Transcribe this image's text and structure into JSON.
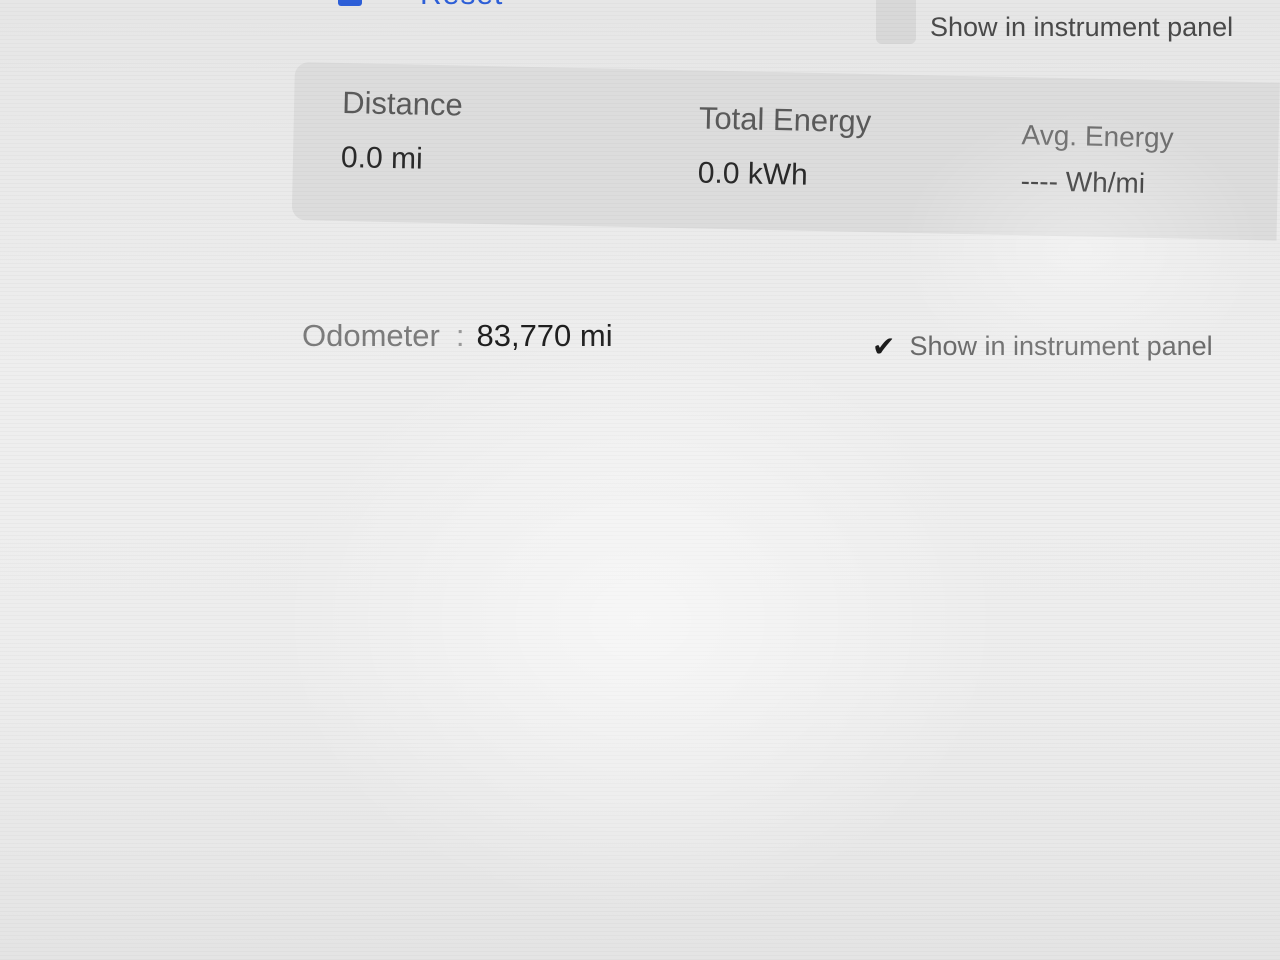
{
  "header": {
    "reset_label": "Reset",
    "show_in_panel_label": "Show in instrument panel"
  },
  "trip": {
    "distance": {
      "label": "Distance",
      "value": "0.0 mi"
    },
    "total_energy": {
      "label": "Total Energy",
      "value": "0.0 kWh"
    },
    "avg_energy": {
      "label": "Avg. Energy",
      "value": "---- Wh/mi"
    }
  },
  "odometer": {
    "label": "Odometer",
    "separator": ":",
    "value": "83,770 mi",
    "show_in_panel": {
      "checked": true,
      "check_glyph": "✔",
      "label": "Show in instrument panel"
    }
  }
}
